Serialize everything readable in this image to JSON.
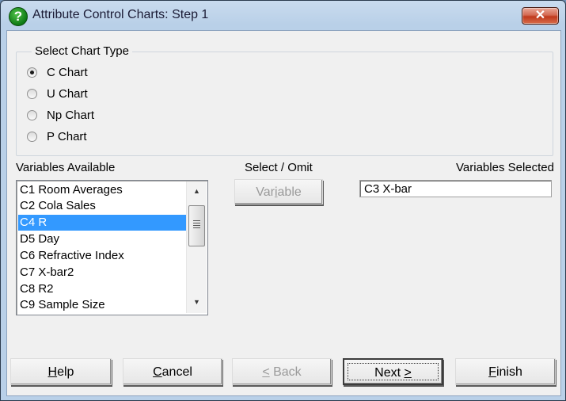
{
  "window": {
    "title": "Attribute Control Charts: Step 1",
    "close_symbol": "✕"
  },
  "chart_type": {
    "legend": "Select Chart Type",
    "options": [
      {
        "label": "C Chart",
        "checked": true
      },
      {
        "label": "U Chart",
        "checked": false
      },
      {
        "label": "Np Chart",
        "checked": false
      },
      {
        "label": "P Chart",
        "checked": false
      }
    ]
  },
  "variables_available": {
    "label": "Variables Available",
    "items": [
      {
        "label": "C1 Room Averages",
        "selected": false
      },
      {
        "label": "C2 Cola Sales",
        "selected": false
      },
      {
        "label": "C4 R",
        "selected": true
      },
      {
        "label": "D5 Day",
        "selected": false
      },
      {
        "label": "C6 Refractive Index",
        "selected": false
      },
      {
        "label": "C7 X-bar2",
        "selected": false
      },
      {
        "label": "C8 R2",
        "selected": false
      },
      {
        "label": "C9 Sample Size",
        "selected": false
      }
    ]
  },
  "select_omit": {
    "label": "Select / Omit",
    "button_pre": "Var",
    "button_accel": "i",
    "button_post": "able"
  },
  "variables_selected": {
    "label": "Variables Selected",
    "value": "C3 X-bar"
  },
  "buttons": {
    "help": {
      "accel": "H",
      "rest": "elp"
    },
    "cancel": {
      "accel": "C",
      "rest": "ancel"
    },
    "back": {
      "accel": "<",
      "rest": " Back"
    },
    "next": {
      "pre": "Next ",
      "accel": ">"
    },
    "finish": {
      "accel": "F",
      "rest": "inish"
    }
  }
}
